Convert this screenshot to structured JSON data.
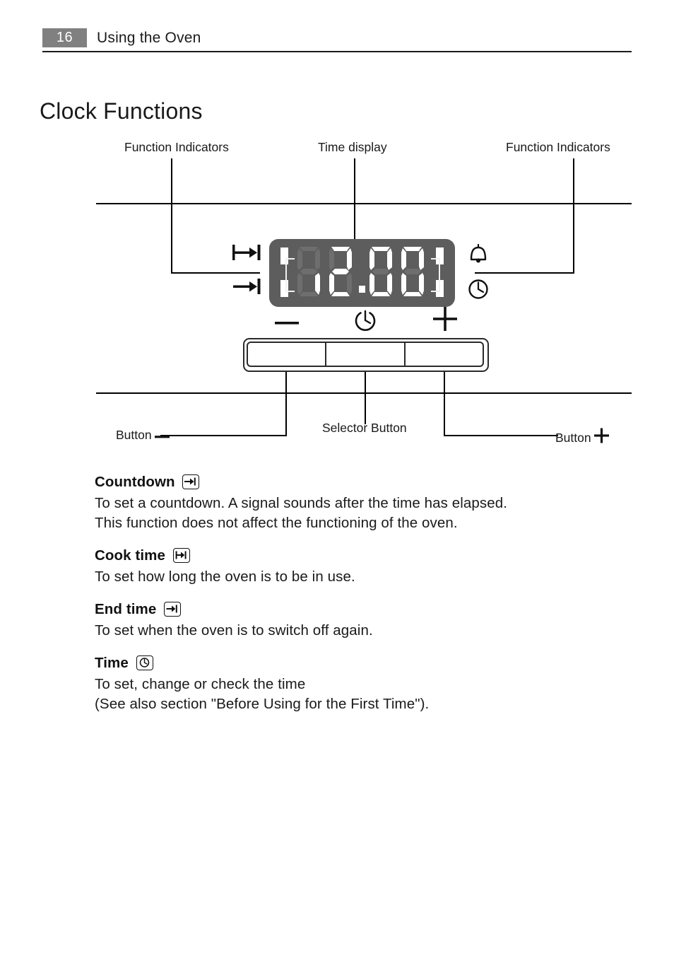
{
  "header": {
    "page_number": "16",
    "title": "Using the Oven"
  },
  "section": {
    "title": "Clock Functions"
  },
  "diagram": {
    "callouts": {
      "function_indicators_left": "Function Indicators",
      "time_display": "Time display",
      "function_indicators_right": "Function Indicators",
      "button_minus": "Button",
      "selector_button": "Selector Button",
      "button_plus": "Button"
    },
    "display": {
      "value": "12.00",
      "digits": [
        "1",
        "2",
        "0",
        "0"
      ],
      "decimal_point": true,
      "panel_color": "#5d5d5d",
      "lit_segment_color": "#ffffff",
      "unlit_segment_color": "#6e6e6e"
    },
    "indicator_icons": {
      "left_top": "cook-time-icon",
      "left_bottom": "end-time-icon",
      "right_top": "bell-icon",
      "right_bottom": "clock-icon"
    },
    "button_symbols": {
      "minus": "minus-icon",
      "selector": "selector-clock-icon",
      "plus": "plus-icon"
    },
    "buttons_count": 3
  },
  "functions": [
    {
      "name": "Countdown",
      "icon": "countdown-icon",
      "lines": [
        "To set a countdown. A signal sounds after the time has elapsed.",
        "This function does not affect the functioning of the oven."
      ]
    },
    {
      "name": "Cook time",
      "icon": "cook-time-icon",
      "lines": [
        "To set how long the oven is to be in use."
      ]
    },
    {
      "name": "End time",
      "icon": "end-time-icon",
      "lines": [
        "To set when the oven is to switch off again."
      ]
    },
    {
      "name": "Time",
      "icon": "clock-icon",
      "lines": [
        "To set, change or check the time",
        "(See also section \"Before Using for the First Time\")."
      ]
    }
  ]
}
